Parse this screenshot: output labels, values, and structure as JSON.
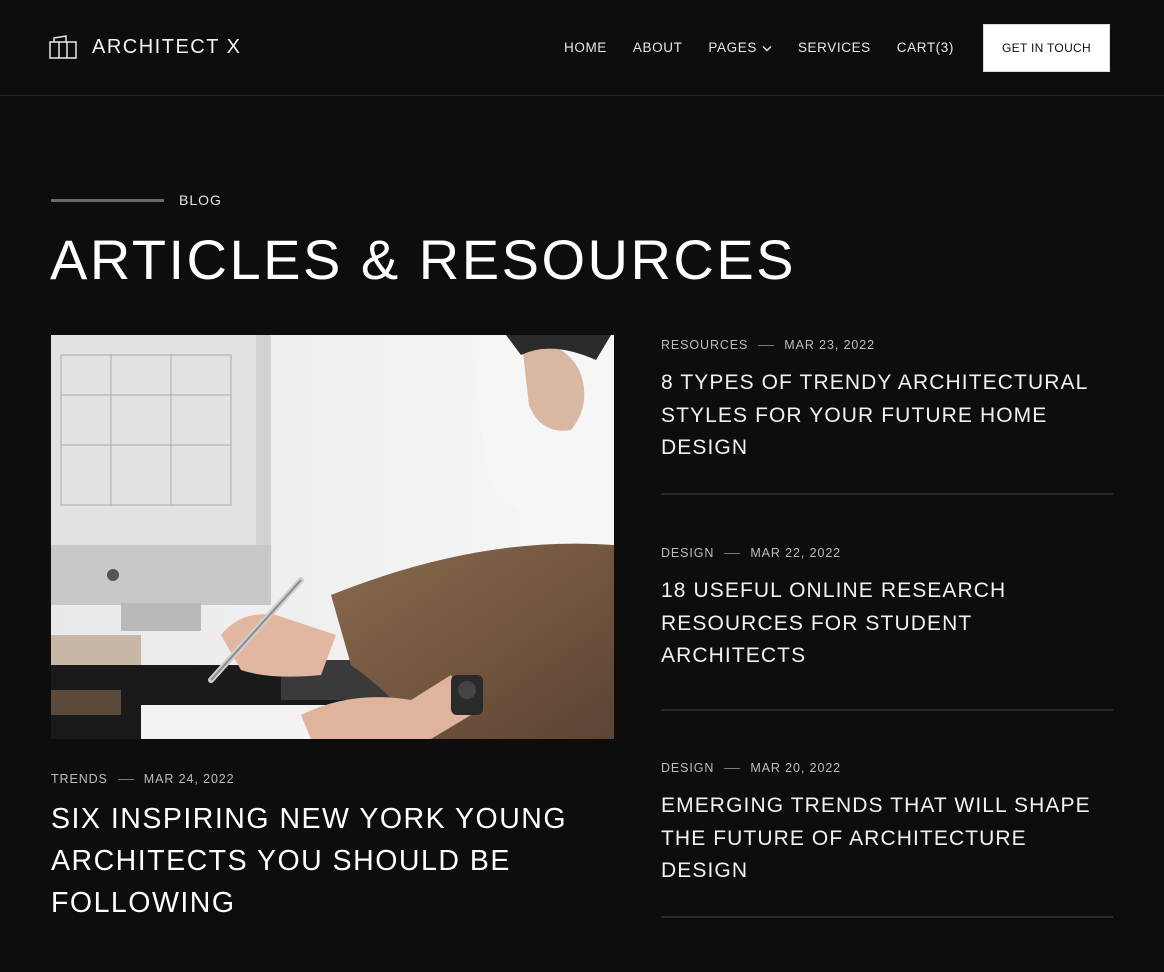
{
  "header": {
    "brand": "ARCHITECT X",
    "nav": [
      {
        "label": "HOME"
      },
      {
        "label": "ABOUT"
      },
      {
        "label": "PAGES"
      },
      {
        "label": "SERVICES"
      },
      {
        "label": "CART(3)"
      }
    ],
    "cta": "GET IN TOUCH"
  },
  "hero": {
    "eyebrow": "BLOG",
    "title": "ARTICLES & RESOURCES"
  },
  "featured": {
    "category": "TRENDS",
    "date": "MAR 24, 2022",
    "title": "SIX INSPIRING NEW YORK YOUNG ARCHITECTS YOU SHOULD BE FOLLOWING"
  },
  "articles": [
    {
      "category": "RESOURCES",
      "date": "MAR 23, 2022",
      "title": "8 TYPES OF TRENDY ARCHITECTURAL STYLES FOR YOUR FUTURE HOME DESIGN"
    },
    {
      "category": "DESIGN",
      "date": "MAR 22, 2022",
      "title": "18 USEFUL ONLINE RESEARCH RESOURCES FOR STUDENT ARCHITECTS"
    },
    {
      "category": "DESIGN",
      "date": "MAR 20, 2022",
      "title": "EMERGING TRENDS THAT WILL SHAPE THE FUTURE OF ARCHITECTURE DESIGN"
    }
  ],
  "icons": {
    "brand": "building-icon",
    "pages_dropdown": "chevron-down-icon"
  }
}
